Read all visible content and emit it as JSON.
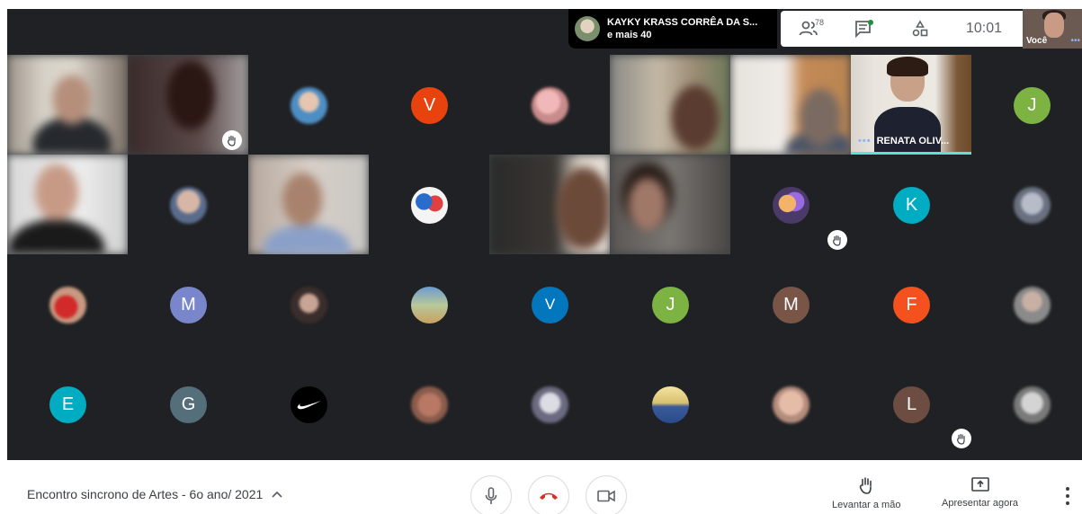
{
  "top": {
    "presenter_name": "KAYKY KRASS CORRÊA DA S...",
    "presenter_more": "e mais 40",
    "people_count": "78",
    "time": "10:01",
    "self_label": "Você",
    "self_dots": "•••"
  },
  "tiles": {
    "r1c8_label": "RENATA OLIV...",
    "r1c8_dots": "•••",
    "avatars": {
      "r1c4": "V",
      "r1c9": "J",
      "r2c8": "K",
      "r3c2": "M",
      "r3c5": "V",
      "r3c6": "J",
      "r3c7": "M",
      "r3c8": "F",
      "r4c1": "E",
      "r4c2": "G",
      "r4c8": "L"
    }
  },
  "colors": {
    "V_orange": "#e8430f",
    "J_green": "#7cb342",
    "K_teal": "#00acc1",
    "M_purple": "#7986cb",
    "V_blue": "#0277bd",
    "M_brown": "#795548",
    "F_orange": "#f4511e",
    "E_teal": "#00acc1",
    "G_slate": "#546e7a",
    "L_brown": "#6d4c41",
    "stage_bg": "#202124",
    "tile_bg": "#3c4043",
    "hangup_red": "#d93025"
  },
  "bottom": {
    "meeting_title": "Encontro sincrono de Artes - 6o ano/ 2021",
    "raise_hand_label": "Levantar a mão",
    "present_now_label": "Apresentar agora"
  }
}
